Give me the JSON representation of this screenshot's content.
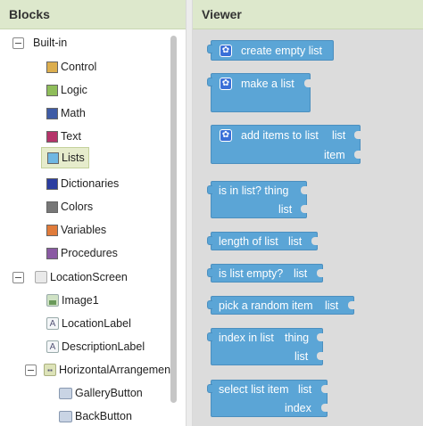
{
  "left_panel": {
    "title": "Blocks",
    "builtin_label": "Built-in",
    "categories": [
      {
        "label": "Control",
        "color": "#dcae4e"
      },
      {
        "label": "Logic",
        "color": "#8fbd5a"
      },
      {
        "label": "Math",
        "color": "#3f5ca6"
      },
      {
        "label": "Text",
        "color": "#b5346a"
      },
      {
        "label": "Lists",
        "color": "#6fb7e3"
      },
      {
        "label": "Dictionaries",
        "color": "#2b3da0"
      },
      {
        "label": "Colors",
        "color": "#777777"
      },
      {
        "label": "Variables",
        "color": "#e07b3a"
      },
      {
        "label": "Procedures",
        "color": "#8a5aa3"
      }
    ],
    "selected_category": "Lists",
    "screen_label": "LocationScreen",
    "components": [
      {
        "label": "Image1",
        "icon": "image-icon"
      },
      {
        "label": "LocationLabel",
        "icon": "label-icon"
      },
      {
        "label": "DescriptionLabel",
        "icon": "label-icon"
      },
      {
        "label": "HorizontalArrangemen",
        "icon": "horizontal-arrangement-icon"
      },
      {
        "label": "GalleryButton",
        "icon": "button-icon"
      },
      {
        "label": "BackButton",
        "icon": "button-icon"
      }
    ]
  },
  "viewer": {
    "title": "Viewer",
    "blocks": [
      {
        "name": "create-empty-list-block",
        "lines": [
          "create empty list"
        ],
        "gear": true
      },
      {
        "name": "make-a-list-block",
        "lines": [
          "make a list"
        ],
        "gear": true
      },
      {
        "name": "add-items-to-list-block",
        "lines": [
          "add items to list",
          "list",
          "item"
        ],
        "gear": true
      },
      {
        "name": "is-in-list-block",
        "lines": [
          "is in list? thing",
          "list"
        ]
      },
      {
        "name": "length-of-list-block",
        "lines": [
          "length of list",
          "list"
        ]
      },
      {
        "name": "is-list-empty-block",
        "lines": [
          "is list empty?",
          "list"
        ]
      },
      {
        "name": "pick-random-item-block",
        "lines": [
          "pick a random item",
          "list"
        ]
      },
      {
        "name": "index-in-list-block",
        "lines": [
          "index in list",
          "thing",
          "list"
        ]
      },
      {
        "name": "select-list-item-block",
        "lines": [
          "select list item",
          "list",
          "index"
        ]
      }
    ]
  }
}
